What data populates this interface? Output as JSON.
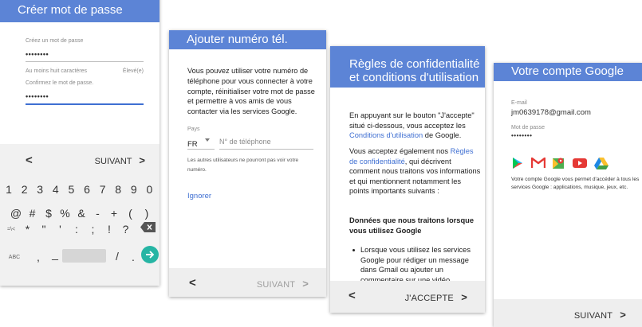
{
  "screen1": {
    "title": "Créer mot de passe",
    "create_label": "Créez un mot de passe",
    "password_value": "••••••••",
    "hint_left": "Au moins huit caractères",
    "hint_right": "Élevé(e)",
    "confirm_label": "Confirmez le mot de passe.",
    "confirm_value": "••••••••",
    "back_label": "<",
    "next_label": "SUIVANT",
    "next_chevron": ">",
    "keys_row1": [
      "1",
      "2",
      "3",
      "4",
      "5",
      "6",
      "7",
      "8",
      "9",
      "0"
    ],
    "keys_row2": [
      "@",
      "#",
      "$",
      "%",
      "&",
      "-",
      "+",
      "(",
      ")"
    ],
    "keys_row3": [
      "=\\<",
      "*",
      "\"",
      "'",
      ":",
      ";",
      "!",
      "?"
    ],
    "keys_row4_left": "ABC",
    "keys_row4_comma": ",",
    "keys_row4_underscore": "_",
    "keys_row4_slash": "/",
    "keys_row4_dot": "."
  },
  "screen2": {
    "title": "Ajouter numéro tél.",
    "body": "Vous pouvez utiliser votre numéro de téléphone pour vous connecter à votre compte, réinitialiser votre mot de passe et permettre à vos amis de vous contacter via les services Google.",
    "country_label": "Pays",
    "country_value": "FR",
    "phone_placeholder": "N° de téléphone",
    "note": "Les autres utilisateurs ne pourront pas voir votre numéro.",
    "skip_label": "Ignorer",
    "back_label": "<",
    "next_label": "SUIVANT",
    "next_chevron": ">"
  },
  "screen3": {
    "title": "Règles de confidentialité et conditions d'utilisation",
    "p1_a": "En appuyant sur le bouton \"J'accepte\" situé ci-dessous, vous acceptez les ",
    "p1_link": "Conditions d'utilisation",
    "p1_b": " de Google.",
    "p2_a": "Vous acceptez également nos ",
    "p2_link": "Règles de confidentialité",
    "p2_b": ", qui décrivent comment nous traitons vos informations et qui mentionnent notamment les points importants suivants :",
    "heading": "Données que nous traitons lorsque vous utilisez Google",
    "bullet": "Lorsque vous utilisez les services Google pour rédiger un message dans Gmail ou ajouter un commentaire sur une vidéo",
    "back_label": "<",
    "next_label": "J'ACCEPTE",
    "next_chevron": ">"
  },
  "screen4": {
    "title": "Votre compte Google",
    "email_label": "E-mail",
    "email_value": "jm0639178@gmail.com",
    "password_label": "Mot de passe",
    "password_value": "••••••••",
    "services_text": "Votre compte Google vous permet d'accéder à tous les services Google : applications, musique, jeux, etc.",
    "next_label": "SUIVANT",
    "next_chevron": ">"
  },
  "colors": {
    "header_blue": "#5c84d6",
    "link_blue": "#3f6fd2",
    "fab_teal": "#26b5a4"
  },
  "icons": [
    "play-store-icon",
    "gmail-icon",
    "maps-icon",
    "youtube-icon",
    "drive-icon"
  ]
}
